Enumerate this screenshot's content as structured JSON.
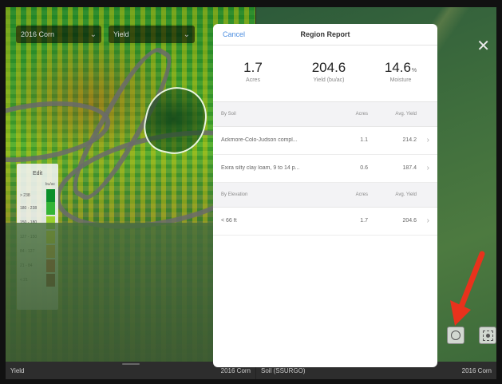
{
  "left_map": {
    "crop_dropdown": "2016 Corn",
    "layer_dropdown": "Yield",
    "legend": {
      "edit_label": "Edit",
      "unit": "bu/ac",
      "rows": [
        {
          "label": "> 238",
          "color": "#0a8f2a"
        },
        {
          "label": "180 - 238",
          "color": "#34b436"
        },
        {
          "label": "150 - 180",
          "color": "#9ad12d"
        },
        {
          "label": "127 - 150",
          "color": "#e9de25"
        },
        {
          "label": "84 - 127",
          "color": "#f0a02e"
        },
        {
          "label": "21 - 84",
          "color": "#d8331f"
        },
        {
          "label": "< 21",
          "color": "#8c0f12"
        }
      ]
    }
  },
  "right_map": {
    "close_icon": "close-icon",
    "tools": [
      "circle-draw-icon",
      "focus-icon"
    ]
  },
  "bottom_left": {
    "layer": "Yield",
    "crop": "2016 Corn"
  },
  "bottom_right": {
    "layer": "Soil (SSURGO)",
    "crop": "2016 Corn"
  },
  "panel": {
    "cancel": "Cancel",
    "title": "Region Report",
    "stats": {
      "acres_value": "1.7",
      "acres_label": "Acres",
      "yield_value": "204.6",
      "yield_label": "Yield (bu/ac)",
      "moisture_value": "14.6",
      "moisture_unit": "%",
      "moisture_label": "Moisture"
    },
    "by_soil": {
      "header": "By Soil",
      "col_acres": "Acres",
      "col_yield": "Avg. Yield",
      "rows": [
        {
          "name": "Ackmore-Colo-Judson compl...",
          "acres": "1.1",
          "yield": "214.2"
        },
        {
          "name": "Exira silty clay loam, 9 to 14 p...",
          "acres": "0.6",
          "yield": "187.4"
        }
      ]
    },
    "by_elevation": {
      "header": "By Elevation",
      "col_acres": "Acres",
      "col_yield": "Avg. Yield",
      "rows": [
        {
          "name": "< 66 ft",
          "acres": "1.7",
          "yield": "204.6"
        }
      ]
    }
  },
  "accent_color": "#4a8de0",
  "arrow_color": "#e8321c"
}
